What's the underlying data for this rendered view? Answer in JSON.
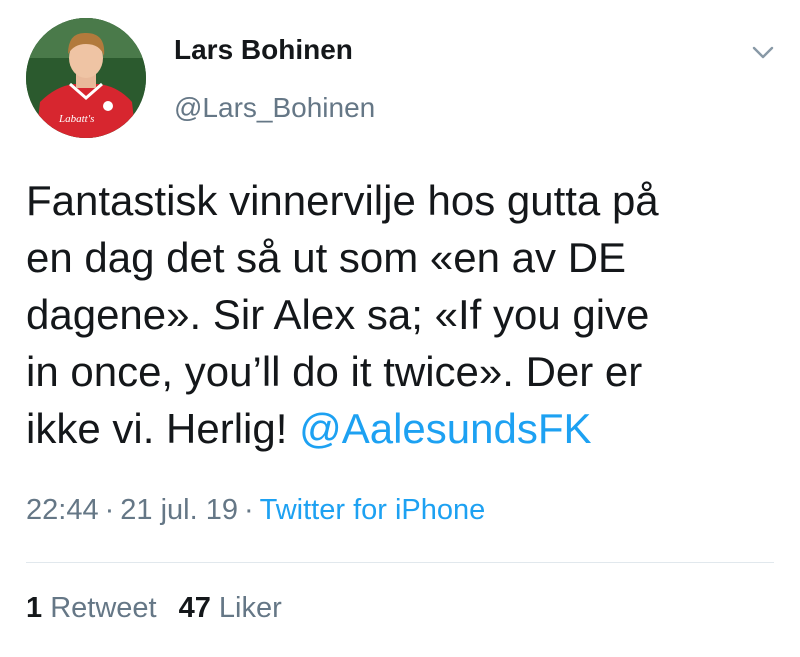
{
  "author": {
    "name": "Lars Bohinen",
    "handle": "@Lars_Bohinen",
    "avatar_shirt_text": "Labatt's"
  },
  "tweet": {
    "lines": [
      "Fantastisk vinnervilje hos gutta på",
      "en dag det så ut som «en av DE",
      "dagene». Sir Alex sa; «If you give",
      "in once, you’ll do it twice». Der er",
      "ikke vi. Herlig! "
    ],
    "mention": "@AalesundsFK"
  },
  "meta": {
    "time": "22:44",
    "separator": "·",
    "date": "21 jul. 19",
    "source": "Twitter for iPhone"
  },
  "stats": {
    "retweets_count": "1",
    "retweets_label": "Retweet",
    "likes_count": "47",
    "likes_label": "Liker"
  },
  "icons": {
    "menu": "chevron-down-icon"
  },
  "colors": {
    "text": "#14171a",
    "secondary": "#657786",
    "link": "#1da1f2",
    "divider": "#e1e8ed",
    "shirt": "#d7262f"
  }
}
